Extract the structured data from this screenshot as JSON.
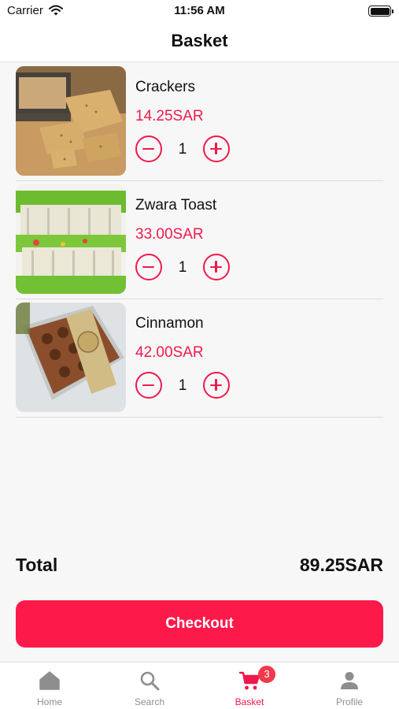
{
  "status_bar": {
    "carrier": "Carrier",
    "time": "11:56 AM"
  },
  "header": {
    "title": "Basket"
  },
  "items": [
    {
      "name": "Crackers",
      "price": "14.25SAR",
      "quantity": "1"
    },
    {
      "name": "Zwara Toast",
      "price": "33.00SAR",
      "quantity": "1"
    },
    {
      "name": "Cinnamon",
      "price": "42.00SAR",
      "quantity": "1"
    }
  ],
  "summary": {
    "total_label": "Total",
    "total_value": "89.25SAR"
  },
  "checkout": {
    "label": "Checkout"
  },
  "tabs": [
    {
      "label": "Home",
      "icon": "home-icon"
    },
    {
      "label": "Search",
      "icon": "search-icon"
    },
    {
      "label": "Basket",
      "icon": "cart-icon",
      "badge": "3",
      "active": true
    },
    {
      "label": "Profile",
      "icon": "person-icon"
    }
  ],
  "colors": {
    "accent": "#f0194c",
    "checkout": "#fd1a4a",
    "inactive_tab": "#8e8e8e"
  }
}
